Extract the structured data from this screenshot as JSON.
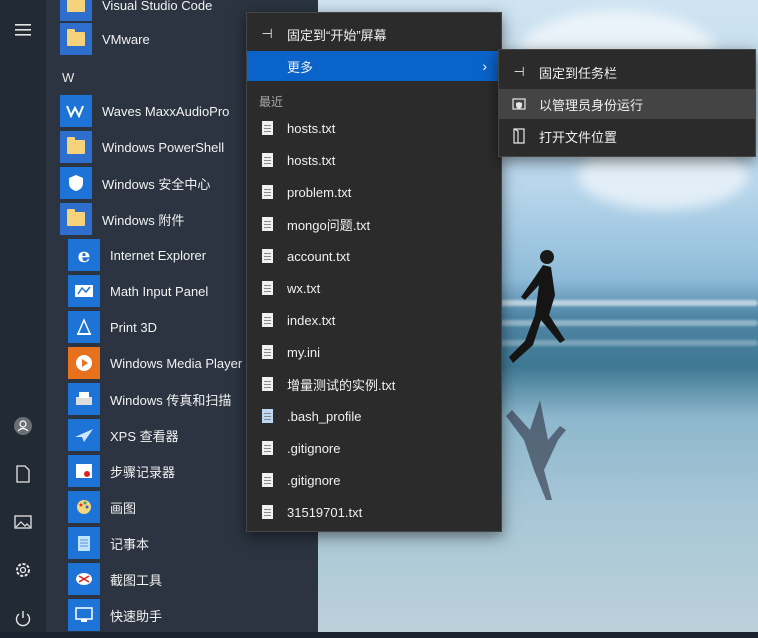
{
  "start_menu": {
    "rail": [
      "menu-icon",
      "user-icon",
      "documents-icon",
      "pictures-icon",
      "settings-icon",
      "power-icon"
    ],
    "section_w": "W",
    "apps": [
      {
        "label": "Visual Studio Code",
        "icon": "folder-icon"
      },
      {
        "label": "VMware",
        "icon": "folder-icon"
      },
      {
        "label": "Waves MaxxAudioPro",
        "icon": "waves-icon"
      },
      {
        "label": "Windows PowerShell",
        "icon": "folder-icon"
      },
      {
        "label": "Windows 安全中心",
        "icon": "shield-icon"
      },
      {
        "label": "Windows 附件",
        "icon": "folder-icon"
      }
    ],
    "sub_apps": [
      {
        "label": "Internet Explorer",
        "icon": "ie-icon"
      },
      {
        "label": "Math Input Panel",
        "icon": "math-input-icon"
      },
      {
        "label": "Print 3D",
        "icon": "print3d-icon"
      },
      {
        "label": "Windows Media Player",
        "icon": "media-player-icon"
      },
      {
        "label": "Windows 传真和扫描",
        "icon": "fax-scan-icon"
      },
      {
        "label": "XPS 查看器",
        "icon": "xps-viewer-icon"
      },
      {
        "label": "步骤记录器",
        "icon": "steps-recorder-icon"
      },
      {
        "label": "画图",
        "icon": "paint-icon"
      },
      {
        "label": "记事本",
        "icon": "notepad-icon"
      },
      {
        "label": "截图工具",
        "icon": "snipping-tool-icon"
      },
      {
        "label": "快速助手",
        "icon": "quick-assist-icon"
      }
    ]
  },
  "context_menu": {
    "pin_start": "固定到“开始”屏幕",
    "more": "更多",
    "recent_header": "最近",
    "recent": [
      "hosts.txt",
      "hosts.txt",
      "problem.txt",
      "mongo问题.txt",
      "account.txt",
      "wx.txt",
      "index.txt",
      "my.ini",
      "增量测试的实例.txt",
      ".bash_profile",
      ".gitignore",
      ".gitignore",
      "31519701.txt"
    ]
  },
  "submenu": {
    "pin_taskbar": "固定到任务栏",
    "run_admin": "以管理员身份运行",
    "open_location": "打开文件位置"
  },
  "colors": {
    "accent": "#0a63c9",
    "menu_bg": "#2b2b2b",
    "start_bg": "#2b3440"
  }
}
